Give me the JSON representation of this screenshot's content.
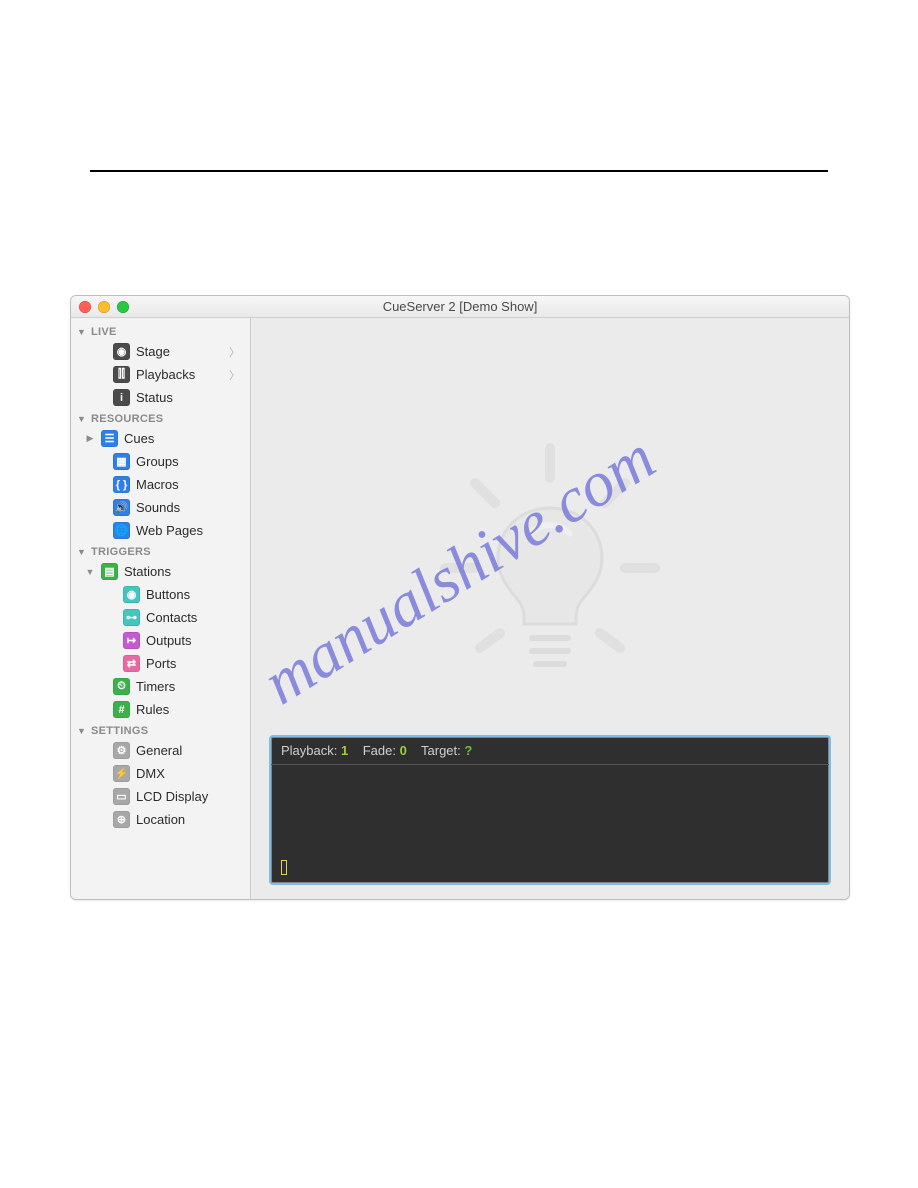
{
  "window_title": "CueServer 2 [Demo Show]",
  "watermark": "manualshive.com",
  "sidebar": {
    "sections": [
      {
        "label": "LIVE",
        "items": [
          {
            "label": "Stage",
            "icon": "eye",
            "color": "#4b4b4b",
            "glyph": "◉",
            "chev": true,
            "indent": 20
          },
          {
            "label": "Playbacks",
            "icon": "sliders",
            "color": "#4b4b4b",
            "glyph": "⫿⫿",
            "chev": true,
            "indent": 20
          },
          {
            "label": "Status",
            "icon": "info",
            "color": "#4b4b4b",
            "glyph": "i",
            "chev": false,
            "indent": 20
          }
        ]
      },
      {
        "label": "RESOURCES",
        "items": [
          {
            "label": "Cues",
            "icon": "list",
            "color": "#2f7fe6",
            "glyph": "☰",
            "exp": "▶",
            "indent": 8
          },
          {
            "label": "Groups",
            "icon": "grid",
            "color": "#2f7fe6",
            "glyph": "▦",
            "indent": 20
          },
          {
            "label": "Macros",
            "icon": "brackets",
            "color": "#2f7fe6",
            "glyph": "{ }",
            "indent": 20
          },
          {
            "label": "Sounds",
            "icon": "sound",
            "color": "#2f7fe6",
            "glyph": "🔊",
            "indent": 20
          },
          {
            "label": "Web Pages",
            "icon": "globe",
            "color": "#2f7fe6",
            "glyph": "🌐",
            "indent": 20
          }
        ]
      },
      {
        "label": "TRIGGERS",
        "items": [
          {
            "label": "Stations",
            "icon": "stations",
            "color": "#3cb14b",
            "glyph": "▤",
            "exp": "▼",
            "indent": 8
          },
          {
            "label": "Buttons",
            "icon": "buttons",
            "color": "#44c5be",
            "glyph": "◉",
            "indent": 30
          },
          {
            "label": "Contacts",
            "icon": "contacts",
            "color": "#44c5be",
            "glyph": "⊶",
            "indent": 30
          },
          {
            "label": "Outputs",
            "icon": "outputs",
            "color": "#c35bd1",
            "glyph": "↦",
            "indent": 30
          },
          {
            "label": "Ports",
            "icon": "ports",
            "color": "#e76aa3",
            "glyph": "⇄",
            "indent": 30
          },
          {
            "label": "Timers",
            "icon": "timers",
            "color": "#3cb14b",
            "glyph": "⏲",
            "indent": 20
          },
          {
            "label": "Rules",
            "icon": "rules",
            "color": "#3cb14b",
            "glyph": "#",
            "indent": 20
          }
        ]
      },
      {
        "label": "SETTINGS",
        "items": [
          {
            "label": "General",
            "icon": "gear",
            "color": "#a8a8a8",
            "glyph": "⚙",
            "indent": 20
          },
          {
            "label": "DMX",
            "icon": "bolt",
            "color": "#a8a8a8",
            "glyph": "⚡",
            "indent": 20
          },
          {
            "label": "LCD Display",
            "icon": "lcd",
            "color": "#a8a8a8",
            "glyph": "▭",
            "indent": 20
          },
          {
            "label": "Location",
            "icon": "target",
            "color": "#a8a8a8",
            "glyph": "⊕",
            "indent": 20
          }
        ]
      }
    ]
  },
  "console": {
    "playback_label": "Playback:",
    "playback_value": "1",
    "fade_label": "Fade:",
    "fade_value": "0",
    "target_label": "Target:",
    "target_value": "?"
  }
}
